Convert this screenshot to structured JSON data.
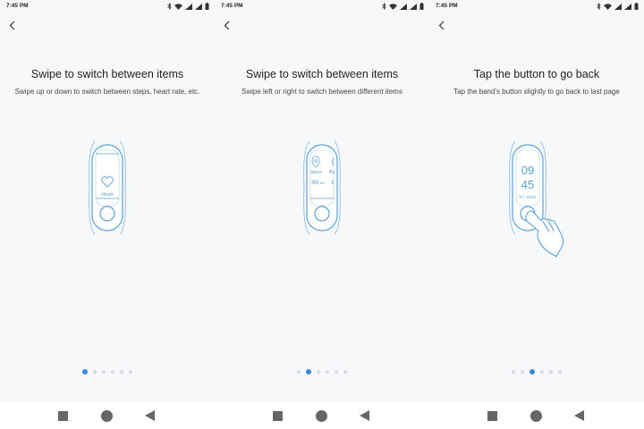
{
  "screens": [
    {
      "status_time": "7:45 PM",
      "title": "Swipe to switch between items",
      "subtitle": "Swipe up or down to switch between steps, heart rate, etc.",
      "band_label": "Heart",
      "active_dot": 0
    },
    {
      "status_time": "7:45 PM",
      "title": "Swipe to switch between items",
      "subtitle": "Swipe left or right to switch between different items",
      "band_left_label": "tance",
      "band_left_value": ".98",
      "band_left_unit": "km",
      "band_right_label": "Bu",
      "band_right_value": "1",
      "active_dot": 1
    },
    {
      "status_time": "7:45 PM",
      "title": "Tap the button to go back",
      "subtitle": "Tap the band's button slightly to go back to last page",
      "band_hour": "09",
      "band_minute": "45",
      "band_date": "Fri. 10/24",
      "active_dot": 2
    }
  ],
  "page_dots_count": 6,
  "icons": {
    "status": [
      "bluetooth-icon",
      "wifi-icon",
      "signal-icon",
      "signal-icon",
      "battery-icon"
    ],
    "back": "chevron-left-icon",
    "nav": [
      "recent-apps-icon",
      "home-icon",
      "back-icon"
    ]
  },
  "colors": {
    "background": "#f7f8fa",
    "band_outline": "#5aa1d8",
    "active_dot": "#3b87d9",
    "inactive_dot": "#d6dce3",
    "nav_icon": "#666666"
  }
}
